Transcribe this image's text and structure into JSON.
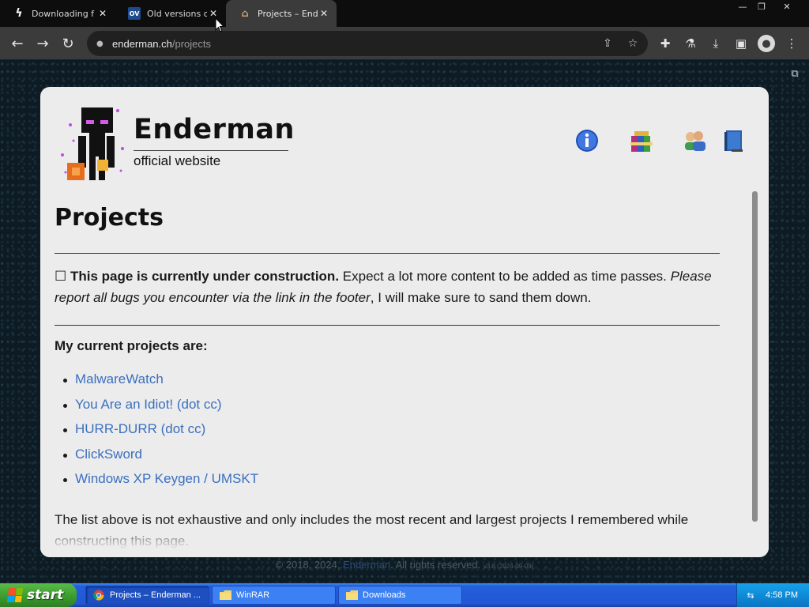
{
  "browser": {
    "tabs": [
      {
        "title": "Downloading f",
        "icon": "lightning-icon",
        "active": false
      },
      {
        "title": "Old versions o",
        "icon": "oldversion-icon",
        "active": false
      },
      {
        "title": "Projects – End",
        "icon": "enderman-icon",
        "active": true
      }
    ],
    "url_host": "enderman.ch",
    "url_path": "/projects"
  },
  "site": {
    "name": "Enderman",
    "tagline": "official website"
  },
  "page": {
    "heading": "Projects",
    "notice_bold": "This page is currently under construction.",
    "notice_text": " Expect a lot more content to be added as time passes. ",
    "notice_italic": "Please report all bugs you encounter via the link in the footer",
    "notice_end": ", I will make sure to sand them down.",
    "list_heading": "My current projects are:",
    "projects": [
      "MalwareWatch",
      "You Are an Idiot! (dot cc)",
      "HURR-DURR (dot cc)",
      "ClickSword",
      "Windows XP Keygen / UMSKT"
    ],
    "trailing_text": "The list above is not exhaustive and only includes the most recent and largest projects I remembered while constructing this page."
  },
  "footer": {
    "copyright": "© 2018, 2024, ",
    "author": "Enderman",
    "rights": ". All rights reserved.",
    "version": "v3.8 (2024-09-09)"
  },
  "taskbar": {
    "start_label": "start",
    "items": [
      {
        "label": "Projects – Enderman ...",
        "icon": "chrome-icon",
        "active": true
      },
      {
        "label": "WinRAR",
        "icon": "folder-icon",
        "active": false
      },
      {
        "label": "Downloads",
        "icon": "folder-icon",
        "active": false
      }
    ],
    "clock": "4:58 PM"
  }
}
